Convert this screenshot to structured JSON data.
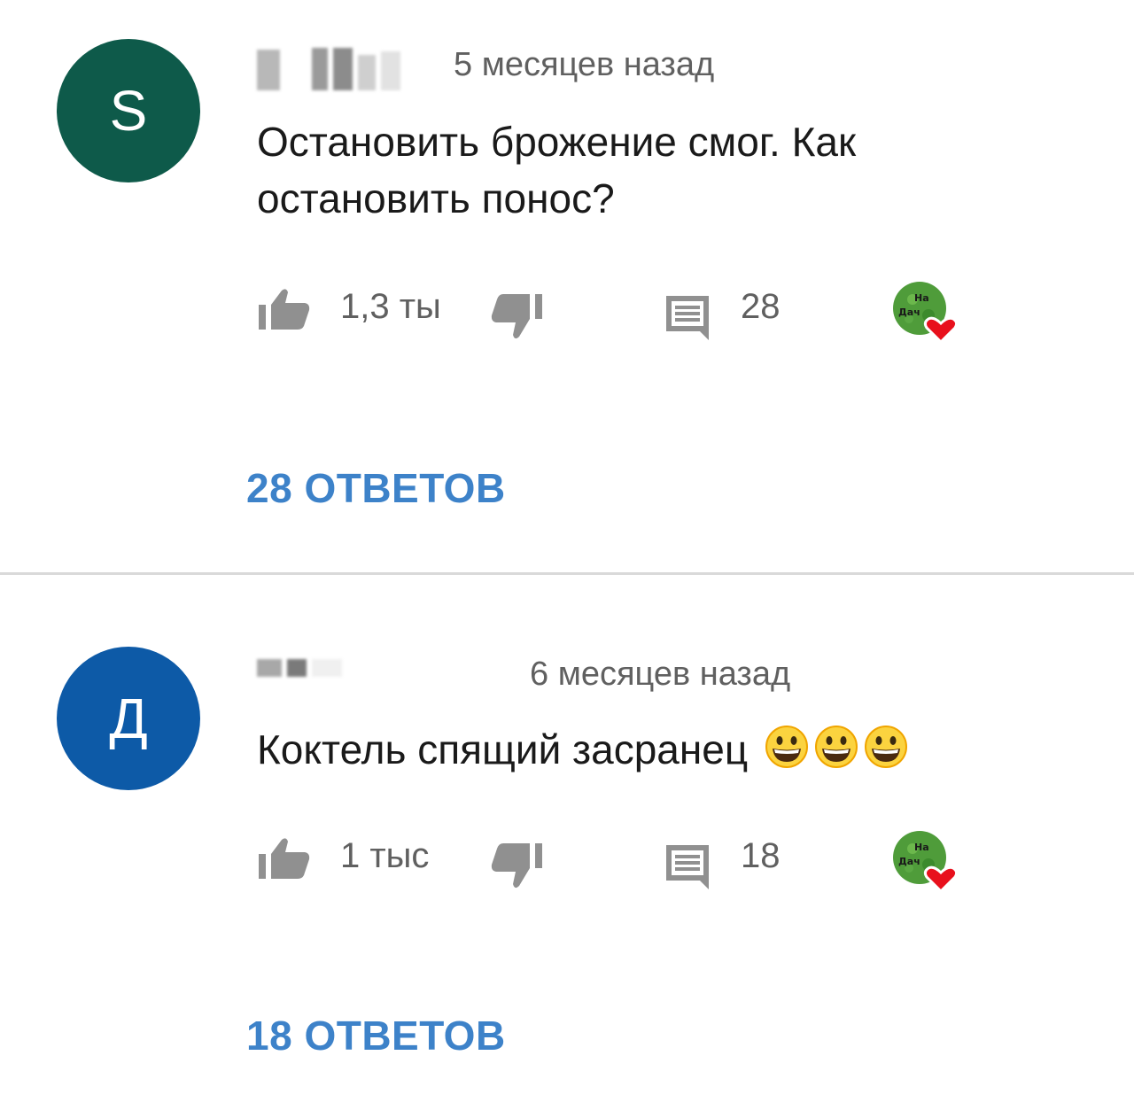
{
  "comments": [
    {
      "avatar_letter": "S",
      "avatar_color": "#0e5a4a",
      "timestamp": "5 месяцев назад",
      "text_line1": "Остановить брожение смог. Как",
      "text_line2": "остановить понос?",
      "emoji_count": 0,
      "likes": "1,3 ты",
      "replies_count": "28",
      "replies_link": "28 ОТВЕТОВ",
      "creator_badge_text": "На Даче"
    },
    {
      "avatar_letter": "Д",
      "avatar_color": "#0d5aa7",
      "timestamp": "6 месяцев назад",
      "text_line1": "Коктель спящий засранец",
      "text_line2": "",
      "emoji_count": 3,
      "likes": "1 тыс",
      "replies_count": "18",
      "replies_link": "18 ОТВЕТОВ",
      "creator_badge_text": "На Даче"
    }
  ],
  "colors": {
    "link_blue": "#3d82c9",
    "heart_red": "#e8101c",
    "icon_gray": "#909090"
  }
}
